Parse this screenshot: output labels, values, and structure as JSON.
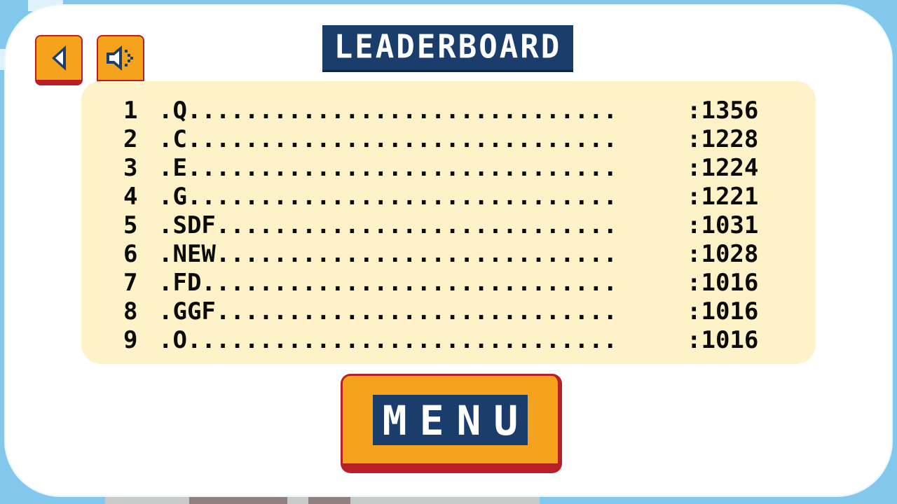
{
  "title": "LEADERBOARD",
  "buttons": {
    "back_icon": "left-triangle-icon",
    "sound_icon": "speaker-icon",
    "menu_label": "MENU"
  },
  "colors": {
    "sky": "#82c8ec",
    "panel": "#ffffff",
    "board": "#fdf2c8",
    "button_fill": "#f5a31c",
    "button_border": "#b91f26",
    "title_bg": "#1b3d6b",
    "text": "#0b0b0b"
  },
  "leaderboard": [
    {
      "rank": "1",
      "name": ".Q..............................",
      "score": ":1356"
    },
    {
      "rank": "2",
      "name": ".C..............................",
      "score": ":1228"
    },
    {
      "rank": "3",
      "name": ".E..............................",
      "score": ":1224"
    },
    {
      "rank": "4",
      "name": ".G..............................",
      "score": ":1221"
    },
    {
      "rank": "5",
      "name": ".SDF............................",
      "score": ":1031"
    },
    {
      "rank": "6",
      "name": ".NEW............................",
      "score": ":1028"
    },
    {
      "rank": "7",
      "name": ".FD.............................",
      "score": ":1016"
    },
    {
      "rank": "8",
      "name": ".GGF............................",
      "score": ":1016"
    },
    {
      "rank": "9",
      "name": ".O..............................",
      "score": ":1016"
    }
  ]
}
